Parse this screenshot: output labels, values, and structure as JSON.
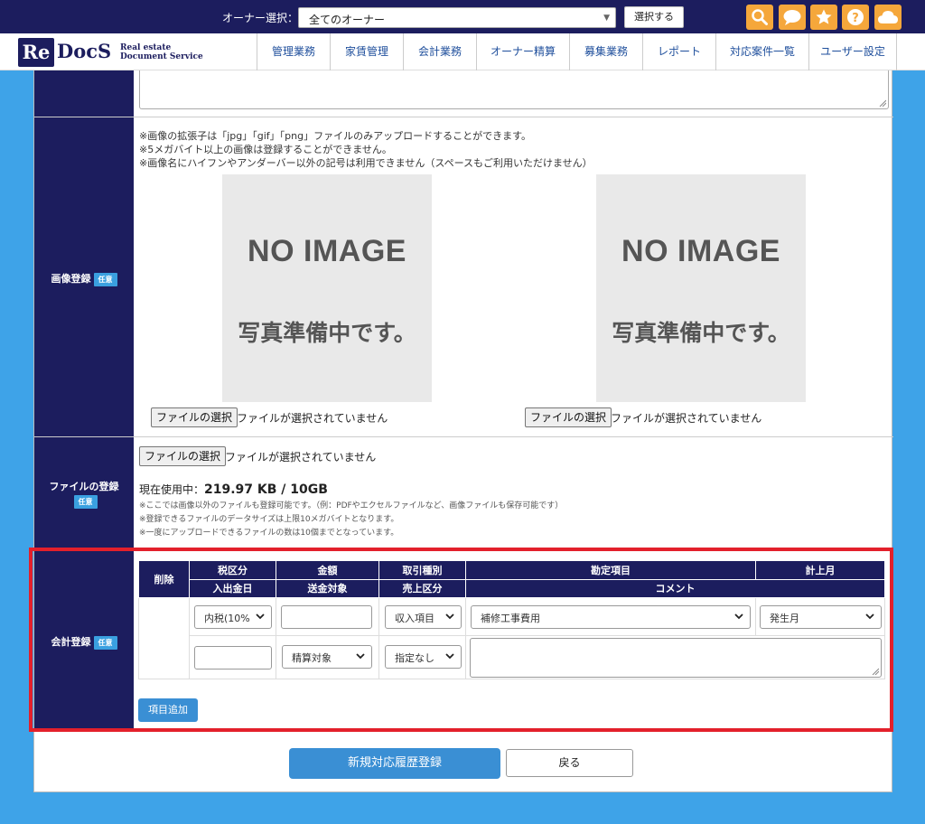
{
  "header": {
    "owner_label": "オーナー選択：",
    "owner_select_value": "全てのオーナー",
    "select_button": "選択する",
    "icons": [
      "search-icon",
      "chat-icon",
      "star-icon",
      "help-icon",
      "cloud-icon"
    ],
    "accent_color": "#f5a73b",
    "brand_color": "#1c1d5e"
  },
  "logo": {
    "mark": "Re",
    "name": "DocS",
    "sub1": "Real estate",
    "sub2": "Document Service"
  },
  "nav": {
    "items": [
      {
        "label": "管理業務"
      },
      {
        "label": "家賃管理"
      },
      {
        "label": "会計業務"
      },
      {
        "label": "オーナー精算"
      },
      {
        "label": "募集業務"
      },
      {
        "label": "レポート"
      },
      {
        "label": "対応案件一覧"
      },
      {
        "label": "ユーザー設定"
      }
    ]
  },
  "image_section": {
    "label": "画像登録",
    "badge": "任意",
    "notes": [
      "※画像の拡張子は「jpg」「gif」「png」ファイルのみアップロードすることができます。",
      "※5メガバイト以上の画像は登録することができません。",
      "※画像名にハイフンやアンダーバー以外の記号は利用できません（スペースもご利用いただけません）"
    ],
    "placeholder_line1": "NO IMAGE",
    "placeholder_line2": "写真準備中です。",
    "file_button": "ファイルの選択",
    "file_status": "ファイルが選択されていません"
  },
  "file_section": {
    "label": "ファイルの登録",
    "badge": "任意",
    "file_button": "ファイルの選択",
    "file_status": "ファイルが選択されていません",
    "usage_label": "現在使用中：",
    "usage_value": "219.97 KB / 10GB",
    "notes": [
      "※ここでは画像以外のファイルも登録可能です。（例：PDFやエクセルファイルなど、画像ファイルも保存可能です）",
      "※登録できるファイルのデータサイズは上限10メガバイトとなります。",
      "※一度にアップロードできるファイルの数は10個までとなっています。"
    ]
  },
  "accounting": {
    "label": "会計登録",
    "badge": "任意",
    "headers_row1": [
      "削除",
      "税区分",
      "金額",
      "取引種別",
      "勘定項目",
      "計上月"
    ],
    "headers_row2": [
      "入出金日",
      "送金対象",
      "売上区分",
      "コメント"
    ],
    "tax_value": "内税(10%",
    "amount_value": "",
    "transaction_value": "収入項目",
    "account_value": "補修工事費用",
    "month_value": "発生月",
    "date_value": "",
    "remit_value": "精算対象",
    "sales_value": "指定なし",
    "comment_value": "",
    "add_button": "項目追加",
    "highlight_color": "#e3202b"
  },
  "actions": {
    "submit": "新規対応履歴登録",
    "back": "戻る"
  }
}
